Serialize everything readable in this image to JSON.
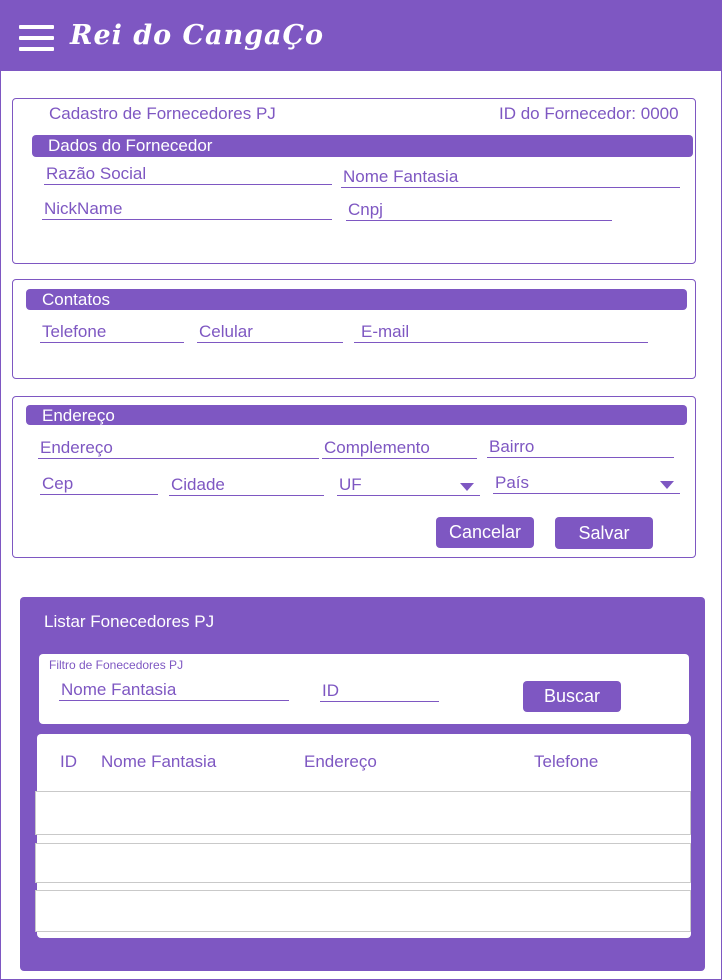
{
  "header": {
    "app_title": "Rei do CangaÇo",
    "menu_icon": "hamburger-menu-icon"
  },
  "cadastro": {
    "title": "Cadastro de Fornecedores  PJ",
    "id_label": "ID do Fornecedor: 0000",
    "section_title": "Dados do Fornecedor",
    "fields": {
      "razao_social": "Razão Social",
      "nome_fantasia": "Nome Fantasia",
      "nickname": "NickName",
      "cnpj": "Cnpj"
    }
  },
  "contatos": {
    "section_title": "Contatos",
    "fields": {
      "telefone": "Telefone",
      "celular": "Celular",
      "email": "E-mail"
    }
  },
  "endereco": {
    "section_title": "Endereço",
    "fields": {
      "endereco": "Endereço",
      "complemento": "Complemento",
      "bairro": "Bairro",
      "cep": "Cep",
      "cidade": "Cidade",
      "uf": "UF",
      "pais": "País"
    },
    "cancel_label": "Cancelar",
    "save_label": "Salvar"
  },
  "listar": {
    "title": "Listar Fonecedores PJ",
    "filter": {
      "label": "Filtro de Fonecedores PJ",
      "nome_fantasia": "Nome Fantasia",
      "id": "ID",
      "search_label": "Buscar"
    },
    "table": {
      "columns": [
        "ID",
        "Nome Fantasia",
        "Endereço",
        "Telefone"
      ],
      "rows": [
        [],
        [],
        []
      ]
    }
  },
  "colors": {
    "accent": "#7e57c2",
    "background": "#ffffff",
    "text_on_accent": "#ffffff"
  }
}
